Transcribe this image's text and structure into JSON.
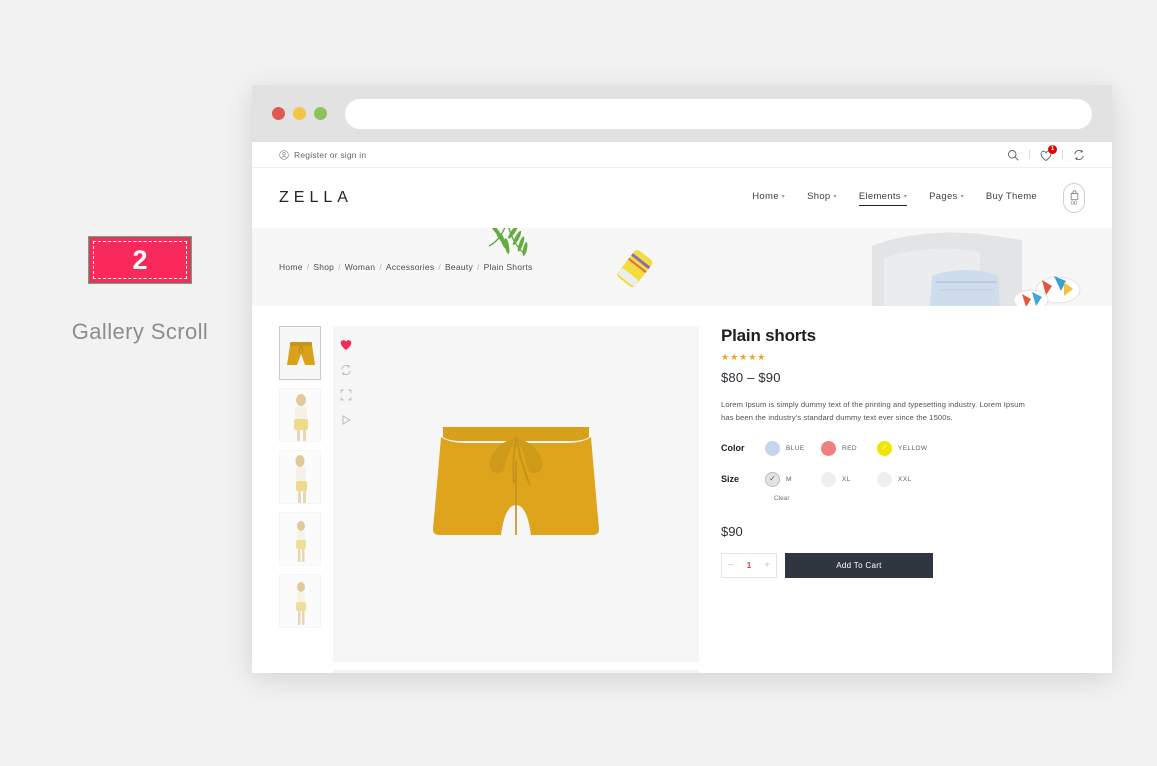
{
  "annotation": {
    "step_number": "2",
    "label": "Gallery Scroll",
    "badge_color": "#f92a5b"
  },
  "browser": {
    "dots": [
      "red",
      "yellow",
      "green"
    ],
    "url_value": ""
  },
  "topbar": {
    "register_label": "Register or sign in",
    "icons": [
      {
        "name": "search-icon",
        "label": "Search"
      },
      {
        "name": "wishlist-icon",
        "label": "Wishlist",
        "badge": "1"
      },
      {
        "name": "compare-icon",
        "label": "Compare"
      }
    ]
  },
  "header": {
    "logo": "ZELLA",
    "nav": [
      {
        "label": "Home",
        "caret": "⌄",
        "active": false
      },
      {
        "label": "Shop",
        "caret": "⌄",
        "active": false
      },
      {
        "label": "Elements",
        "caret": "⌄",
        "active": true
      },
      {
        "label": "Pages",
        "caret": "⌄",
        "active": false
      },
      {
        "label": "Buy Theme",
        "caret": "",
        "active": false
      }
    ],
    "cart_count": "00"
  },
  "banner": {
    "breadcrumb": [
      "Home",
      "Shop",
      "Woman",
      "Accessories",
      "Beauty",
      "Plain Shorts"
    ],
    "separator": "/"
  },
  "gallery": {
    "thumbs": [
      {
        "name": "thumb-shorts-flatlay",
        "selected": true
      },
      {
        "name": "thumb-model-front",
        "selected": false
      },
      {
        "name": "thumb-model-side",
        "selected": false
      },
      {
        "name": "thumb-model-full",
        "selected": false
      },
      {
        "name": "thumb-model-walking",
        "selected": false
      }
    ],
    "stage_icons": [
      {
        "name": "wishlist-heart-icon",
        "active": true
      },
      {
        "name": "compare-icon",
        "active": false
      },
      {
        "name": "fullscreen-icon",
        "active": false
      },
      {
        "name": "play-video-icon",
        "active": false
      }
    ]
  },
  "product": {
    "title": "Plain shorts",
    "rating_stars": "★★★★★",
    "rating_value": 5,
    "price_range": "$80 – $90",
    "description": "Lorem Ipsum is simply dummy text of the printing and typesetting industry. Lorem Ipsum has been the industry's standard dummy text ever since the 1500s.",
    "color_label": "Color",
    "colors": [
      {
        "name": "BLUE",
        "hex": "#c4d5ec",
        "selected": false
      },
      {
        "name": "RED",
        "hex": "#f08080",
        "selected": false
      },
      {
        "name": "YELLOW",
        "hex": "#f2e500",
        "selected": true
      }
    ],
    "size_label": "Size",
    "sizes": [
      {
        "name": "M",
        "selected": true
      },
      {
        "name": "XL",
        "selected": false
      },
      {
        "name": "XXL",
        "selected": false
      }
    ],
    "clear_label": "Clear",
    "final_price": "$90",
    "quantity": "1",
    "qty_minus": "−",
    "qty_plus": "+",
    "add_to_cart_label": "Add To Cart"
  }
}
